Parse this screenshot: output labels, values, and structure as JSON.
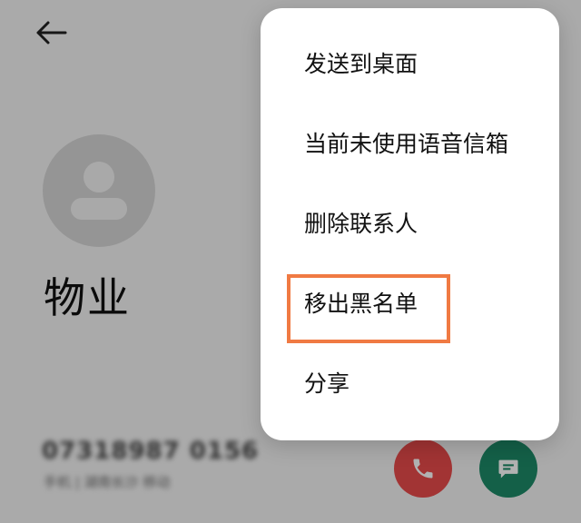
{
  "contact": {
    "name": "物业",
    "phone_number": "07318987 0156",
    "phone_sub": "手机 | 湖南长沙 移动"
  },
  "menu": {
    "items": [
      {
        "label": "发送到桌面"
      },
      {
        "label": "当前未使用语音信箱"
      },
      {
        "label": "删除联系人"
      },
      {
        "label": "移出黑名单"
      },
      {
        "label": "分享"
      }
    ]
  },
  "colors": {
    "highlight": "#f07a43",
    "call_button": "#e84b4b",
    "message_button": "#1e8a67"
  },
  "icons": {
    "back": "arrow-left-icon",
    "avatar": "person-icon",
    "call": "phone-icon",
    "message": "chat-bubble-icon"
  }
}
